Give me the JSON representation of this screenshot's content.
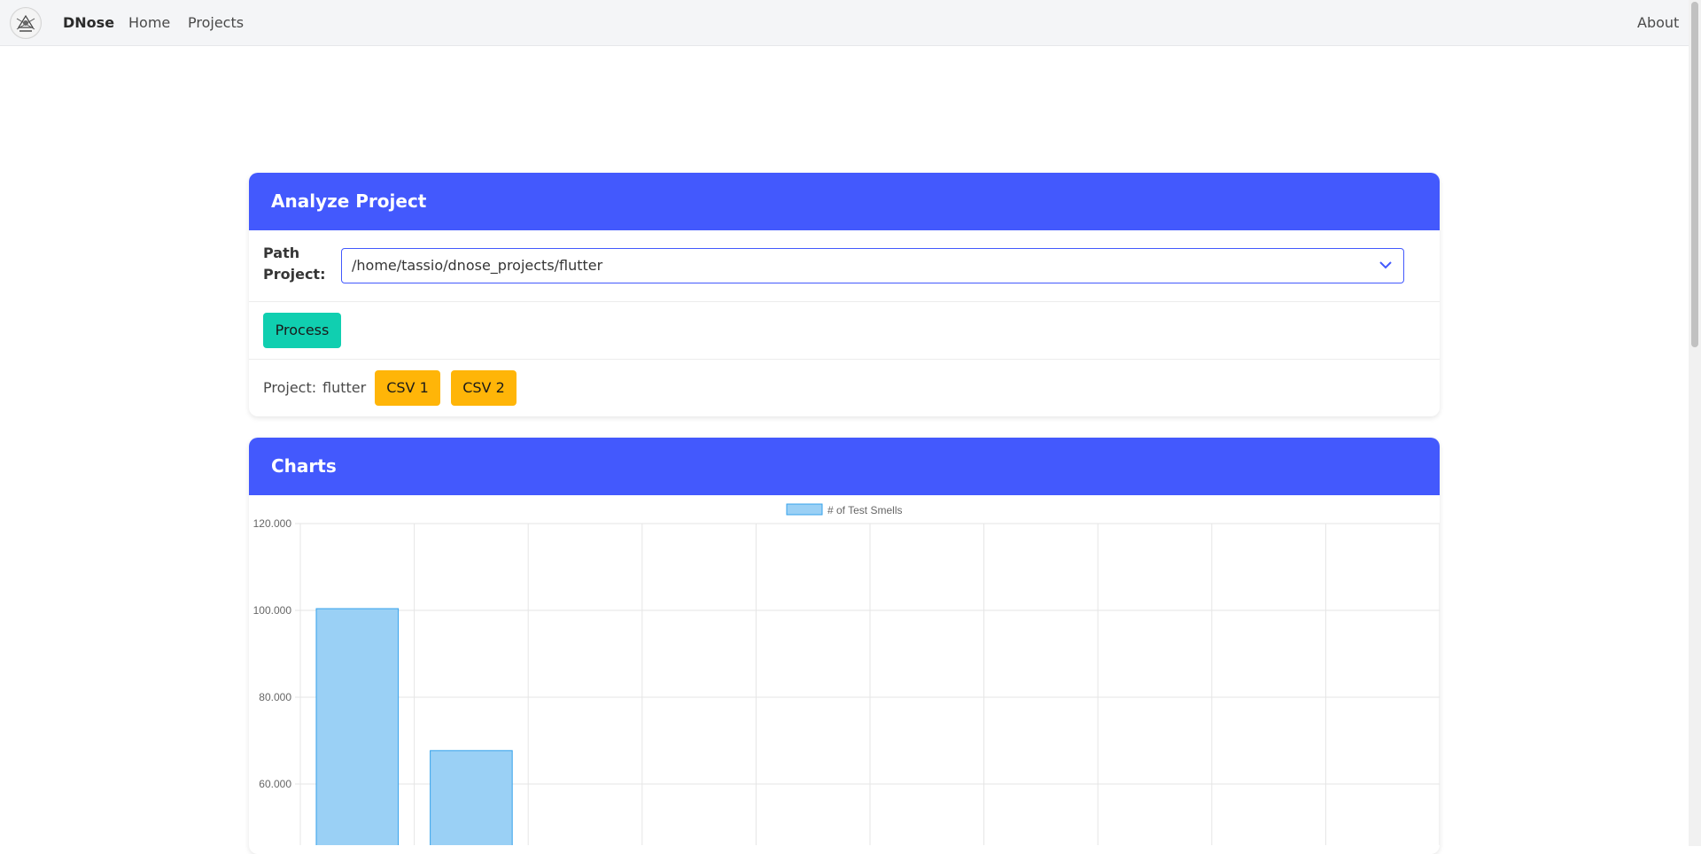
{
  "navbar": {
    "brand": "DNose",
    "links": [
      "Home",
      "Projects"
    ],
    "about": "About",
    "logo_icon": "dnose-logo-icon"
  },
  "analyze": {
    "title": "Analyze Project",
    "path_label": "Path Project:",
    "path_value": "/home/tassio/dnose_projects/flutter",
    "process_label": "Process",
    "project_label": "Project:",
    "project_name": "flutter",
    "csv1_label": "CSV 1",
    "csv2_label": "CSV 2"
  },
  "charts": {
    "title": "Charts"
  },
  "colors": {
    "primary": "#4359fd",
    "success": "#10cfb0",
    "warning": "#ffb508",
    "bar_fill": "#9ad0f5",
    "bar_border": "#36a2eb"
  },
  "chart_data": {
    "type": "bar",
    "legend": [
      "# of Test Smells"
    ],
    "legend_position": "top",
    "yticks": [
      "120.000",
      "100.000",
      "80.000",
      "60.000"
    ],
    "ylim": [
      60000,
      120000
    ],
    "grid": true,
    "category_count": 10,
    "series": [
      {
        "name": "# of Test Smells",
        "values": [
          100400,
          67700
        ]
      }
    ]
  }
}
